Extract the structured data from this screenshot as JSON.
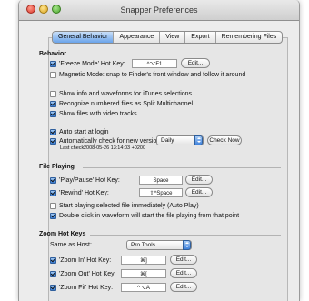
{
  "window": {
    "title": "Snapper Preferences"
  },
  "tabs": [
    "General Behavior",
    "Appearance",
    "View",
    "Export",
    "Remembering Files"
  ],
  "behavior": {
    "heading": "Behavior",
    "freeze": {
      "label": "'Freeze Mode' Hot Key:",
      "checked": true,
      "key": "^⌥F1",
      "edit": "Edit..."
    },
    "magnetic": {
      "label": "Magnetic Mode: snap to Finder's front window and follow it around",
      "checked": false
    },
    "itunes": {
      "label": "Show info and waveforms for iTunes selections",
      "checked": false
    },
    "split": {
      "label": "Recognize numbered files as Split Multichannel",
      "checked": true
    },
    "video": {
      "label": "Show files with video tracks",
      "checked": true
    },
    "autostart": {
      "label": "Auto start at login",
      "checked": true
    },
    "autocheck": {
      "label": "Automatically check for new versions",
      "checked": true,
      "frequency": "Daily",
      "check_now": "Check Now"
    },
    "last_check": {
      "label": "Last check:",
      "value": "2008-05-26 13:14:03 +0200"
    }
  },
  "playing": {
    "heading": "File Playing",
    "playpause": {
      "label": "'Play/Pause' Hot Key:",
      "checked": true,
      "key": "Space",
      "edit": "Edit..."
    },
    "rewind": {
      "label": "'Rewind' Hot Key:",
      "checked": true,
      "key": "⇧^Space",
      "edit": "Edit..."
    },
    "autoplay": {
      "label": "Start playing selected file immediately (Auto Play)",
      "checked": false
    },
    "dblclick": {
      "label": "Double click in waveform will start the file playing from that point",
      "checked": true
    }
  },
  "zoom": {
    "heading": "Zoom Hot Keys",
    "same_as": {
      "label": "Same as Host:",
      "value": "Pro Tools"
    },
    "zoomin": {
      "label": "'Zoom In' Hot Key:",
      "checked": true,
      "key": "⌘]",
      "edit": "Edit..."
    },
    "zoomout": {
      "label": "'Zoom Out' Hot Key:",
      "checked": true,
      "key": "⌘[",
      "edit": "Edit..."
    },
    "zoomfit": {
      "label": "'Zoom Fit' Hot Key:",
      "checked": true,
      "key": "^⌥A",
      "edit": "Edit..."
    }
  }
}
